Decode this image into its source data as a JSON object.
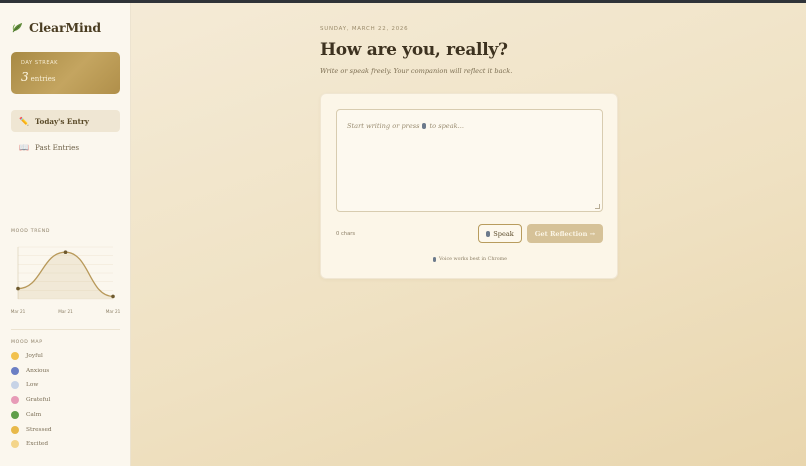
{
  "app": {
    "name": "ClearMind",
    "brand_color": "#4a3d22",
    "accent": "#c4a560"
  },
  "streak": {
    "label": "DAY STREAK",
    "count": "3",
    "unit": "entries"
  },
  "nav": [
    {
      "label": "Today's Entry",
      "icon": "pencil-icon",
      "active": true
    },
    {
      "label": "Past Entries",
      "icon": "book-icon",
      "active": false
    }
  ],
  "mood_trend": {
    "label": "MOOD TREND",
    "chart_data": {
      "type": "line",
      "x": [
        "Mar 21",
        "Mar 21",
        "Mar 21"
      ],
      "values": [
        2,
        9,
        0.5
      ],
      "ylim": [
        0,
        10
      ],
      "grid": true
    }
  },
  "mood_map": {
    "label": "MOOD MAP",
    "items": [
      {
        "label": "Joyful",
        "color": "#f2c14e"
      },
      {
        "label": "Anxious",
        "color": "#6b7fc4"
      },
      {
        "label": "Low",
        "color": "#c7d3e6"
      },
      {
        "label": "Grateful",
        "color": "#e79bb7"
      },
      {
        "label": "Calm",
        "color": "#5f9e4a"
      },
      {
        "label": "Stressed",
        "color": "#e8b94a"
      },
      {
        "label": "Excited",
        "color": "#f4d58a"
      }
    ]
  },
  "main": {
    "date": "SUNDAY, MARCH 22, 2026",
    "title": "How are you, really?",
    "subtitle": "Write or speak freely. Your companion will reflect it back.",
    "placeholder_before": "Start writing or press",
    "placeholder_after": "to speak...",
    "chars": "0 chars",
    "speak_label": "Speak",
    "reflect_label": "Get Reflection →",
    "hint": "Voice works best in Chrome"
  }
}
